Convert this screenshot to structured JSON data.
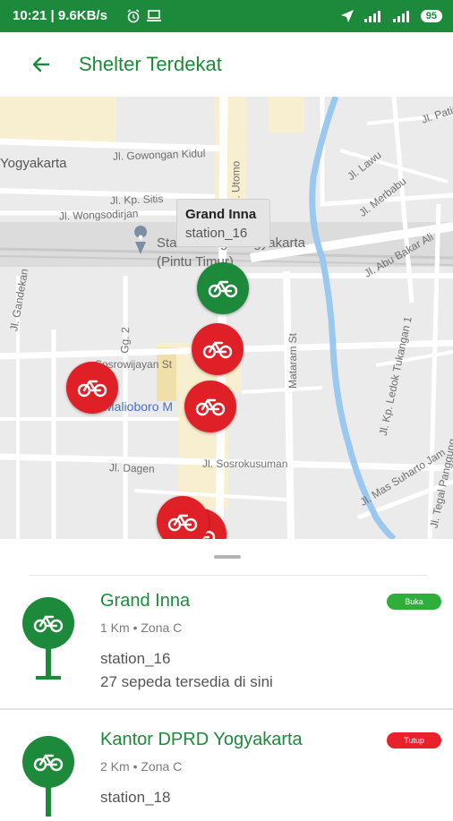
{
  "status_bar": {
    "time": "10:21 | 9.6KB/s",
    "battery": "95",
    "icons": [
      "alarm-icon",
      "laptop-icon",
      "location-arrow-icon",
      "signal-icon",
      "signal-icon",
      "battery-icon"
    ]
  },
  "app_bar": {
    "back_icon": "arrow-left-icon",
    "title": "Shelter Terdekat"
  },
  "map": {
    "labels": {
      "yogyakarta": "Yogyakarta",
      "gowongan": "Jl. Gowongan Kidul",
      "sitisonya": "Jl. Kp. Sitis",
      "wongsodirjan": "Jl. Wongsodirjan",
      "utomo": "Jl. Utomo",
      "patim": "Jl. Patim",
      "lawu": "Jl. Lawu",
      "merbabu": "Jl. Merbabu",
      "abubakar_ali": "Jl. Abu Bakar Ali",
      "station_1": "Stasiun Tugu Yogyakarta",
      "station_2": "(Pintu Timur)",
      "gandekan": "Jl. Gandekan",
      "gg2": "Gg. 2",
      "sosrowijayan": "Sosrowijayan St",
      "malioboro": "Malioboro M",
      "mataram": "Mataram St",
      "ledok": "Jl. Kp. Ledok Tukangan 1",
      "dagen": "Jl. Dagen",
      "sosrokusuman": "Jl. Sosrokusuman",
      "mas_suharto": "Jl. Mas Suharto Jam",
      "tegal": "Jl. Tegal Panggung"
    },
    "tooltip": {
      "name": "Grand Inna",
      "station": "station_16"
    },
    "markers": [
      {
        "name": "Grand Inna",
        "status": "open",
        "icon": "bicycle-icon"
      },
      {
        "name": "shelter",
        "status": "closed",
        "icon": "bicycle-icon"
      },
      {
        "name": "shelter",
        "status": "closed",
        "icon": "bicycle-icon"
      },
      {
        "name": "shelter",
        "status": "closed",
        "icon": "bicycle-icon"
      },
      {
        "name": "shelter",
        "status": "closed",
        "icon": "bicycle-icon"
      },
      {
        "name": "shelter",
        "status": "closed",
        "icon": "bicycle-icon"
      }
    ]
  },
  "shelters": [
    {
      "name": "Grand Inna",
      "distance": "1 Km • Zona C",
      "station": "station_16",
      "availability": "27 sepeda tersedia di sini",
      "status_label": "Buka",
      "status": "open"
    },
    {
      "name": "Kantor DPRD Yogyakarta",
      "distance": "2 Km • Zona C",
      "station": "station_18",
      "availability": "",
      "status_label": "Tutup",
      "status": "closed"
    }
  ],
  "colors": {
    "brand_green": "#1c8a3a",
    "marker_red": "#e02027",
    "badge_open": "#2fae3c",
    "badge_closed": "#e8212b"
  }
}
